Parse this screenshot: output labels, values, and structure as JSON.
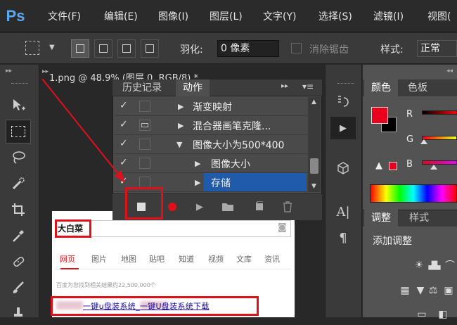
{
  "app": {
    "logo": "Ps"
  },
  "menu": [
    "文件(F)",
    "编辑(E)",
    "图像(I)",
    "图层(L)",
    "文字(Y)",
    "选择(S)",
    "滤镜(I)",
    "视图("
  ],
  "options": {
    "feather_label": "羽化:",
    "feather_value": "0 像素",
    "antialias_label": "消除锯齿",
    "style_label": "样式:",
    "style_value": "正常"
  },
  "document_tab": "1.png @ 48.9% (图层 0, RGB/8) *",
  "history_panel": {
    "tabs": [
      "历史记录",
      "动作"
    ],
    "active_tab": "动作",
    "actions": [
      {
        "label": "渐变映射",
        "checked": true,
        "level": 1
      },
      {
        "label": "混合器画笔克隆...",
        "checked": true,
        "level": 1
      },
      {
        "label": "图像大小为500*400",
        "checked": true,
        "level": 1
      },
      {
        "label": "图像大小",
        "checked": true,
        "level": 2
      },
      {
        "label": "存储",
        "checked": true,
        "level": 2,
        "selected": true
      }
    ]
  },
  "color_panel": {
    "tabs": [
      "颜色",
      "色板"
    ],
    "channels": [
      "R",
      "G",
      "B"
    ],
    "foreground": "#e8001c",
    "background": "#000000"
  },
  "adjust_panel": {
    "tabs": [
      "调整",
      "样式"
    ],
    "title": "添加调整"
  },
  "canvas_page": {
    "search_text": "大白菜",
    "nav": [
      "网页",
      "图片",
      "地图",
      "贴吧",
      "知道",
      "视频",
      "文库",
      "资讯"
    ],
    "result_count": "百度为您找到相关结果约22,500,000个",
    "result_link": "一键u盘装系统_一键U盘装系统下载"
  },
  "colors": {
    "accent_red": "#e0101a",
    "selection_blue": "#1f5ba8"
  }
}
